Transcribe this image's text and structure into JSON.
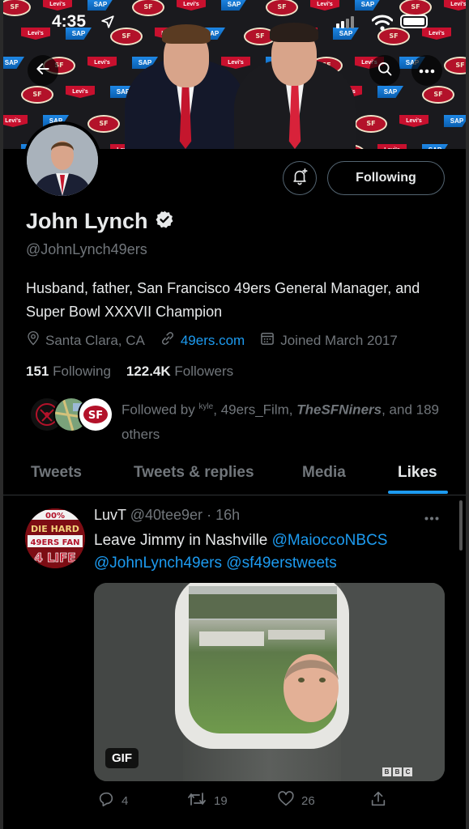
{
  "status_bar": {
    "time": "4:35"
  },
  "banner": {
    "sponsor_levis": "Levi's",
    "sponsor_sap": "SAP",
    "niners_logo": "SF"
  },
  "profile": {
    "name": "John Lynch",
    "handle": "@JohnLynch49ers",
    "bio": "Husband, father, San Francisco 49ers General Manager, and Super Bowl XXXVII Champion",
    "location": "Santa Clara, CA",
    "website": "49ers.com",
    "joined": "Joined March 2017",
    "following_count": "151",
    "following_label": "Following",
    "followers_count": "122.4K",
    "followers_label": "Followers",
    "follow_button": "Following"
  },
  "followed_by": {
    "prefix": "Followed by ",
    "user1": "kyle",
    "sep1": ", ",
    "user2": "49ers_Film",
    "sep2": ", ",
    "user3": "TheSFNiners",
    "suffix": ", and 189 others"
  },
  "tabs": [
    {
      "label": "Tweets"
    },
    {
      "label": "Tweets & replies"
    },
    {
      "label": "Media"
    },
    {
      "label": "Likes"
    }
  ],
  "active_tab": "Likes",
  "tweet": {
    "author_name": "LuvT",
    "author_handle": "@40tee9er",
    "time": "· 16h",
    "text_prefix": "Leave Jimmy in Nashville ",
    "mention1": "@MaioccoNBCS",
    "mention2": "@JohnLynch49ers",
    "mention3": "@sf49erstweets",
    "media_badge": "GIF",
    "media_watermark": "BBC",
    "avatar_text": {
      "top": "00%",
      "mid1": "DIE HARD",
      "mid2": "49ERS FAN",
      "bottom": "4 LIFE"
    },
    "reply_count": "4",
    "retweet_count": "19",
    "like_count": "26"
  },
  "icons": {
    "back": "arrow-left-icon",
    "search": "search-icon",
    "more": "more-icon",
    "bell": "notification-bell-icon",
    "verified": "verified-badge-icon",
    "location": "location-pin-icon",
    "link": "link-icon",
    "calendar": "calendar-icon",
    "reply": "reply-icon",
    "retweet": "retweet-icon",
    "like": "heart-icon",
    "share": "share-icon"
  },
  "colors": {
    "background": "#000000",
    "accent": "#1d9bf0",
    "text_primary": "#e7e9ea",
    "text_secondary": "#71767b",
    "border": "#2f3336",
    "niners_red": "#b3122a"
  }
}
